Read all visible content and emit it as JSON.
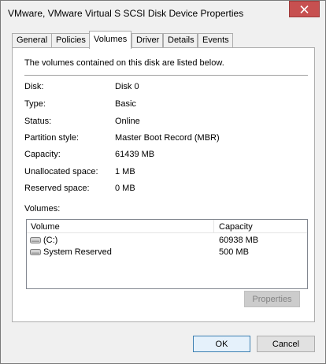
{
  "window": {
    "title": "VMware, VMware Virtual S SCSI Disk Device Properties",
    "close_label": "close"
  },
  "tabs": [
    {
      "label": "General",
      "active": false
    },
    {
      "label": "Policies",
      "active": false
    },
    {
      "label": "Volumes",
      "active": true
    },
    {
      "label": "Driver",
      "active": false
    },
    {
      "label": "Details",
      "active": false
    },
    {
      "label": "Events",
      "active": false
    }
  ],
  "panel": {
    "intro": "The volumes contained on this disk are listed below.",
    "properties": [
      {
        "label": "Disk:",
        "value": "Disk 0"
      },
      {
        "label": "Type:",
        "value": "Basic"
      },
      {
        "label": "Status:",
        "value": "Online"
      },
      {
        "label": "Partition style:",
        "value": "Master Boot Record (MBR)"
      },
      {
        "label": "Capacity:",
        "value": "61439 MB"
      },
      {
        "label": "Unallocated space:",
        "value": "1 MB"
      },
      {
        "label": "Reserved space:",
        "value": "0 MB"
      }
    ],
    "volumes_label": "Volumes:",
    "volumes_table": {
      "columns": [
        "Volume",
        "Capacity"
      ],
      "rows": [
        {
          "volume": "(C:)",
          "capacity": "60938 MB",
          "icon": "drive-icon"
        },
        {
          "volume": "System Reserved",
          "capacity": "500 MB",
          "icon": "drive-icon"
        }
      ]
    },
    "properties_button": "Properties"
  },
  "footer": {
    "ok_label": "OK",
    "cancel_label": "Cancel"
  },
  "colors": {
    "close_button": "#c75050",
    "window_bg": "#f0f0f0",
    "panel_bg": "#ffffff"
  }
}
